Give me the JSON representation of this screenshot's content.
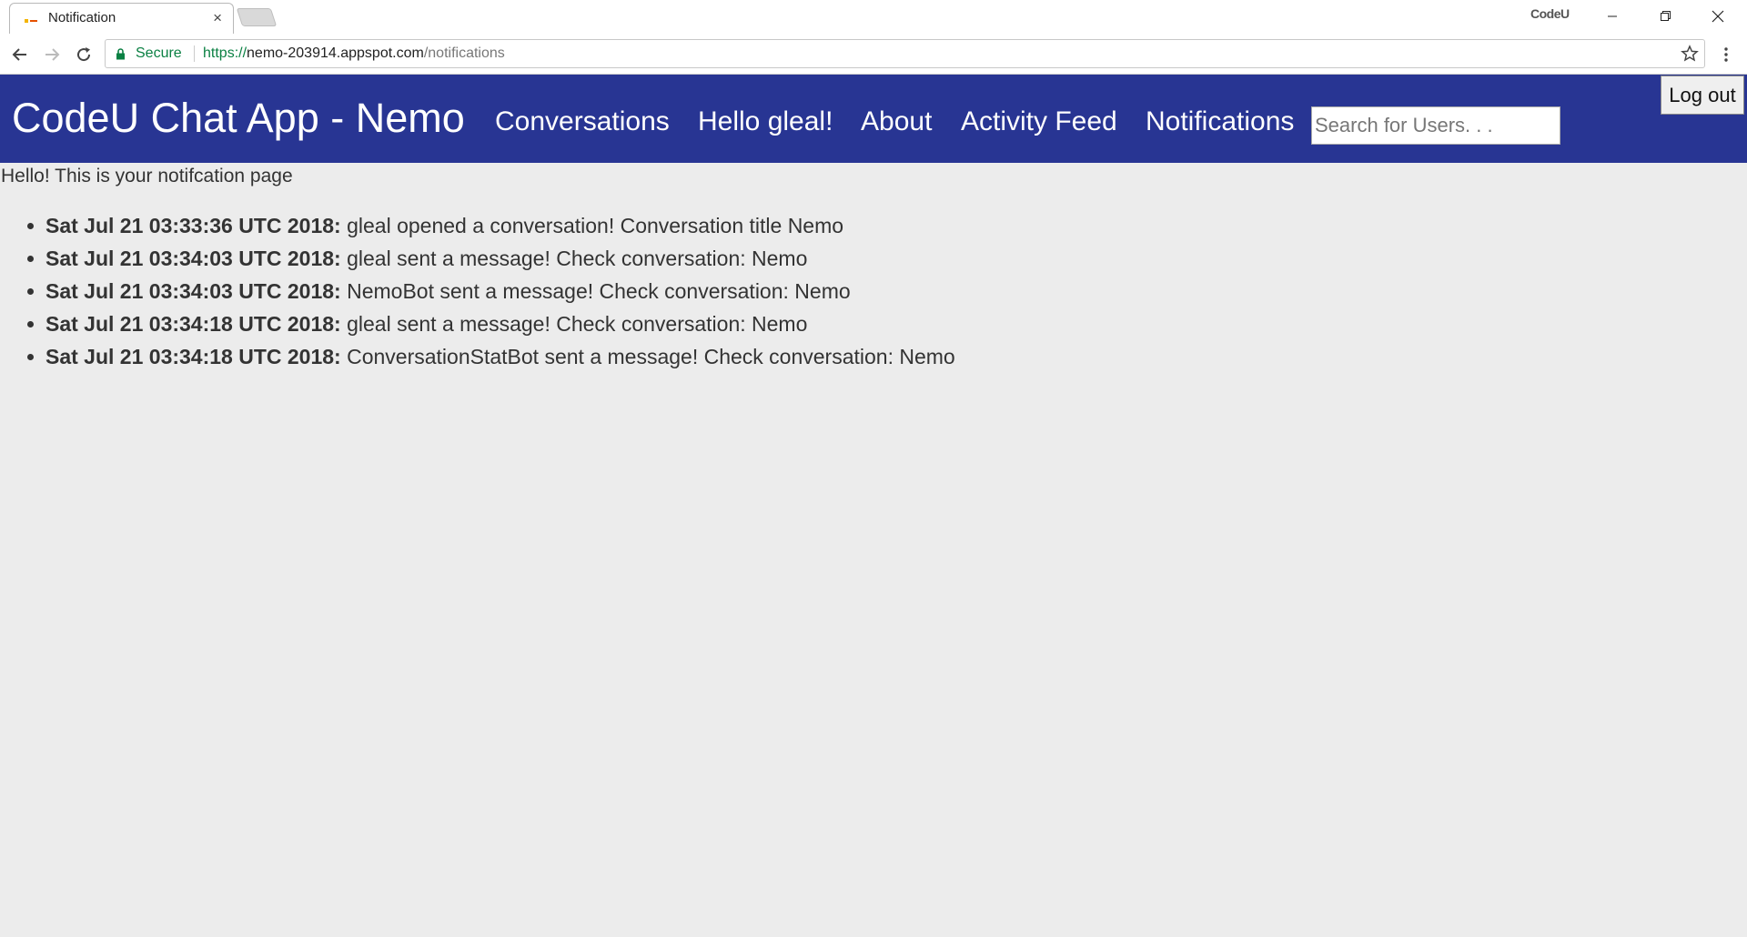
{
  "browser": {
    "tab_title": "Notification",
    "tab_close": "×",
    "profile_label": "CodeU",
    "secure_label": "Secure",
    "url_scheme": "https://",
    "url_host": "nemo-203914.appspot.com",
    "url_path": "/notifications"
  },
  "header": {
    "brand": "CodeU Chat App - Nemo",
    "links": {
      "conversations": "Conversations",
      "hello": "Hello gleal!",
      "about": "About",
      "activity_feed": "Activity Feed",
      "notifications": "Notifications"
    },
    "search_placeholder": "Search for Users. . .",
    "logout_label": "Log out"
  },
  "main": {
    "intro": "Hello! This is your notifcation page",
    "notifications": [
      {
        "timestamp": "Sat Jul 21 03:33:36 UTC 2018:",
        "text": " gleal opened a conversation! Conversation title Nemo"
      },
      {
        "timestamp": "Sat Jul 21 03:34:03 UTC 2018:",
        "text": " gleal sent a message! Check conversation: Nemo"
      },
      {
        "timestamp": "Sat Jul 21 03:34:03 UTC 2018:",
        "text": " NemoBot sent a message! Check conversation: Nemo"
      },
      {
        "timestamp": "Sat Jul 21 03:34:18 UTC 2018:",
        "text": " gleal sent a message! Check conversation: Nemo"
      },
      {
        "timestamp": "Sat Jul 21 03:34:18 UTC 2018:",
        "text": " ConversationStatBot sent a message! Check conversation: Nemo"
      }
    ]
  },
  "colors": {
    "navbar": "#283593",
    "page_background": "#ececec",
    "secure_green": "#0b8043"
  },
  "icons": {
    "favicon": "favicon-icon",
    "new_tab": "new-tab-icon",
    "minimize": "minimize-icon",
    "maximize": "restore-icon",
    "close": "close-icon",
    "back": "back-arrow-icon",
    "forward": "forward-arrow-icon",
    "reload": "reload-icon",
    "lock": "lock-icon",
    "star": "star-icon",
    "menu": "kebab-menu-icon"
  }
}
